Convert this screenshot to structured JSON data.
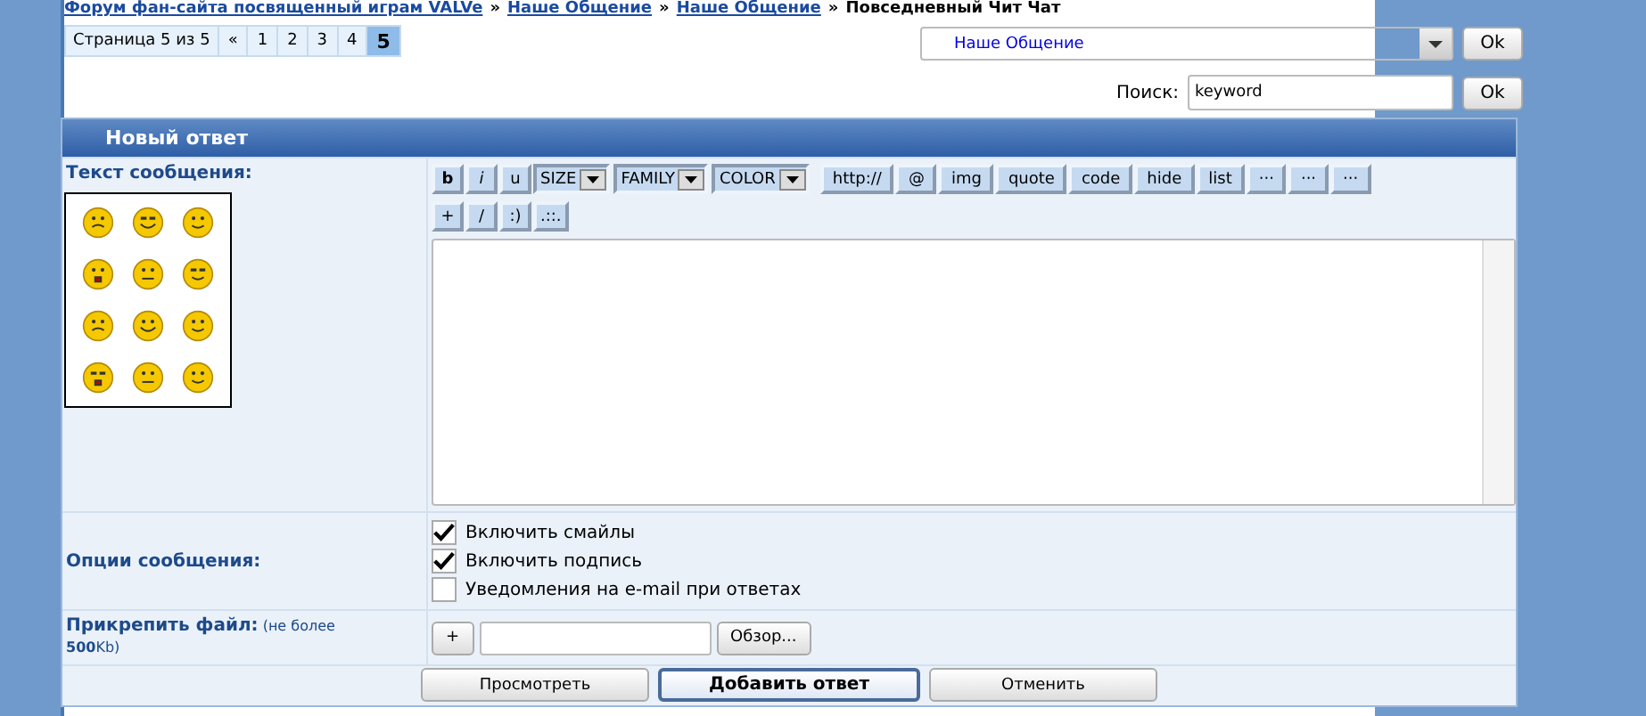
{
  "breadcrumb": {
    "separator": "»",
    "items": [
      {
        "text": "Форум фан-сайта посвященный играм VALVe",
        "kind": "link"
      },
      {
        "text": "Наше Общение",
        "kind": "link"
      },
      {
        "text": "Наше Общение",
        "kind": "link"
      },
      {
        "text": "Повседневный Чит Чат",
        "kind": "current"
      }
    ]
  },
  "pagination": {
    "label": "Страница 5 из 5",
    "pages": [
      {
        "text": "«",
        "selected": false
      },
      {
        "text": "1",
        "selected": false
      },
      {
        "text": "2",
        "selected": false
      },
      {
        "text": "3",
        "selected": false
      },
      {
        "text": "4",
        "selected": false
      },
      {
        "text": "5",
        "selected": true
      }
    ]
  },
  "forum_jump": {
    "value": "Наше Общение",
    "button": "Ok"
  },
  "search": {
    "label": "Поиск:",
    "value": "keyword",
    "button": "Ok"
  },
  "reply_form": {
    "title": "Новый ответ",
    "message_label": "Текст сообщения:",
    "toolbar": [
      [
        {
          "text": "b",
          "kind": "bold"
        },
        {
          "text": "i",
          "kind": "italic"
        },
        {
          "text": "u",
          "kind": "plain"
        },
        {
          "text": "SIZE",
          "kind": "dropdown"
        },
        {
          "text": "FAMILY",
          "kind": "dropdown"
        },
        {
          "text": "COLOR",
          "kind": "dropdown"
        },
        {
          "text": "http://",
          "kind": "wide"
        },
        {
          "text": "@",
          "kind": "wide"
        },
        {
          "text": "img",
          "kind": "wide"
        },
        {
          "text": "quote",
          "kind": "wide"
        },
        {
          "text": "code",
          "kind": "wide"
        },
        {
          "text": "hide",
          "kind": "wide"
        },
        {
          "text": "list",
          "kind": "wide"
        },
        {
          "text": "···",
          "kind": "wide"
        },
        {
          "text": "···",
          "kind": "wide"
        },
        {
          "text": "···",
          "kind": "wide"
        }
      ],
      [
        {
          "text": "+",
          "kind": "plain"
        },
        {
          "text": "/",
          "kind": "plain"
        },
        {
          "text": ":)",
          "kind": "plain"
        },
        {
          "text": ".::.",
          "kind": "plain"
        }
      ]
    ],
    "options_label": "Опции сообщения:",
    "options": [
      {
        "text": "Включить смайлы",
        "checked": true
      },
      {
        "text": "Включить подпись",
        "checked": true
      },
      {
        "text": "Уведомления на e-mail при ответах",
        "checked": false
      }
    ],
    "attach_label": "**Прикрепить файл:** (не более **500**Kb)",
    "attach_add": "+",
    "browse": "Обзор...",
    "buttons": [
      {
        "text": "Просмотреть",
        "primary": false
      },
      {
        "text": "Добавить ответ",
        "primary": true
      },
      {
        "text": "Отменить",
        "primary": false
      }
    ]
  }
}
